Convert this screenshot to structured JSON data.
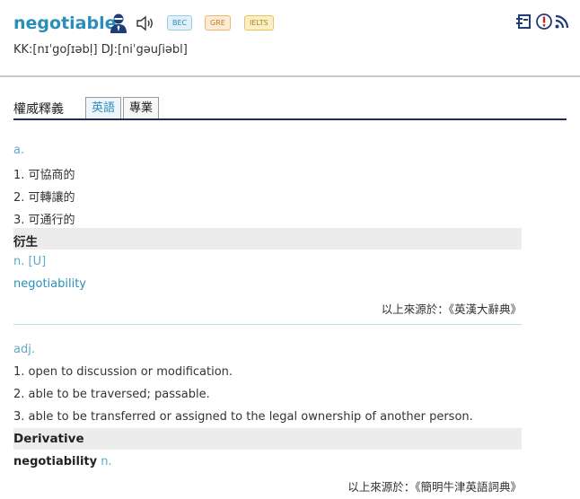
{
  "header": {
    "word": "negotiable",
    "tags": [
      "BEC",
      "GRE",
      "IELTS"
    ],
    "pronunciation": "KK:[nɪˈgoʃɪəbḷ] DJ:[niˈgəuʃiəbl]"
  },
  "tabs": {
    "heading": "權威釋義",
    "items": [
      "英語",
      "專業"
    ]
  },
  "entry1": {
    "pos": "a.",
    "senses": [
      "1. 可協商的",
      "2. 可轉讓的",
      "3. 可通行的"
    ],
    "derivative_heading": "衍生",
    "derivative_pos": "n. [U]",
    "derivative_word": "negotiability",
    "source": "以上來源於：《英漢大辭典》"
  },
  "entry2": {
    "pos": "adj.",
    "senses": [
      "1. open to discussion or modification.",
      "2. able to be traversed; passable.",
      "3. able to be transferred or assigned to the legal ownership of another person."
    ],
    "derivative_heading": "Derivative",
    "derivative_word": "negotiability",
    "derivative_pos": "n.",
    "source": "以上來源於：《簡明牛津英語詞典》"
  },
  "icons": {
    "person": "person-icon",
    "speaker": "speaker-icon",
    "toolbar": [
      "wordbook-icon",
      "report-icon",
      "rss-icon"
    ]
  }
}
